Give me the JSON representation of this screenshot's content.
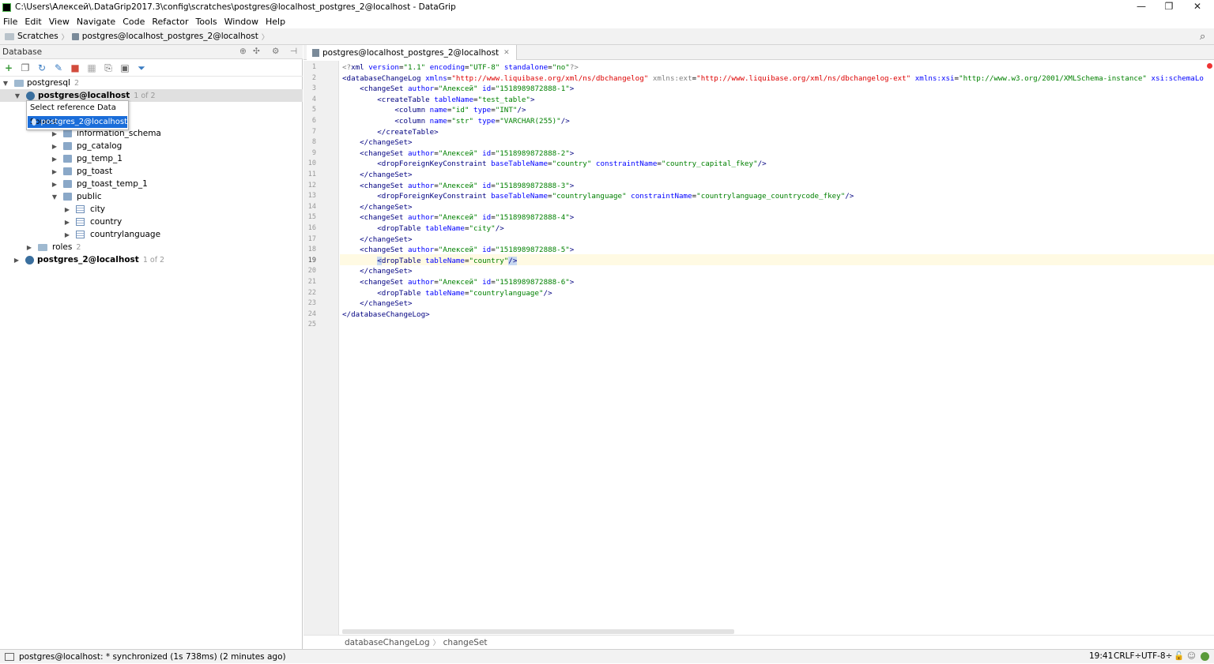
{
  "window": {
    "title": "C:\\Users\\Алексей\\.DataGrip2017.3\\config\\scratches\\postgres@localhost_postgres_2@localhost - DataGrip",
    "minimize": "—",
    "restore": "❐",
    "close": "✕"
  },
  "menu": [
    "File",
    "Edit",
    "View",
    "Navigate",
    "Code",
    "Refactor",
    "Tools",
    "Window",
    "Help"
  ],
  "navbar": {
    "crumb1": "Scratches",
    "crumb2": "postgres@localhost_postgres_2@localhost"
  },
  "left_panel": {
    "title": "Database",
    "tree": {
      "root": {
        "label": "postgresql",
        "count": "2"
      },
      "ds1": {
        "label": "postgres@localhost",
        "count": "1 of 2"
      },
      "schemas": [
        {
          "label": "information_schema"
        },
        {
          "label": "pg_catalog"
        },
        {
          "label": "pg_temp_1"
        },
        {
          "label": "pg_toast"
        },
        {
          "label": "pg_toast_temp_1"
        },
        {
          "label": "public"
        }
      ],
      "tables": [
        "city",
        "country",
        "countrylanguage"
      ],
      "roles": {
        "label": "roles",
        "count": "2"
      },
      "ds2": {
        "label": "postgres_2@localhost",
        "count": "1 of 2"
      }
    },
    "popup": {
      "title": "Select reference Data Source",
      "item": "postgres_2@localhost"
    }
  },
  "editor": {
    "tab": "postgres@localhost_postgres_2@localhost",
    "current_line": 19,
    "breadcrumb": [
      "databaseChangeLog",
      "changeSet"
    ]
  },
  "status": {
    "message": "postgres@localhost: * synchronized (1s 738ms) (2 minutes ago)",
    "position": "19:41",
    "line_sep": "CRLF÷",
    "encoding": "UTF-8÷"
  }
}
